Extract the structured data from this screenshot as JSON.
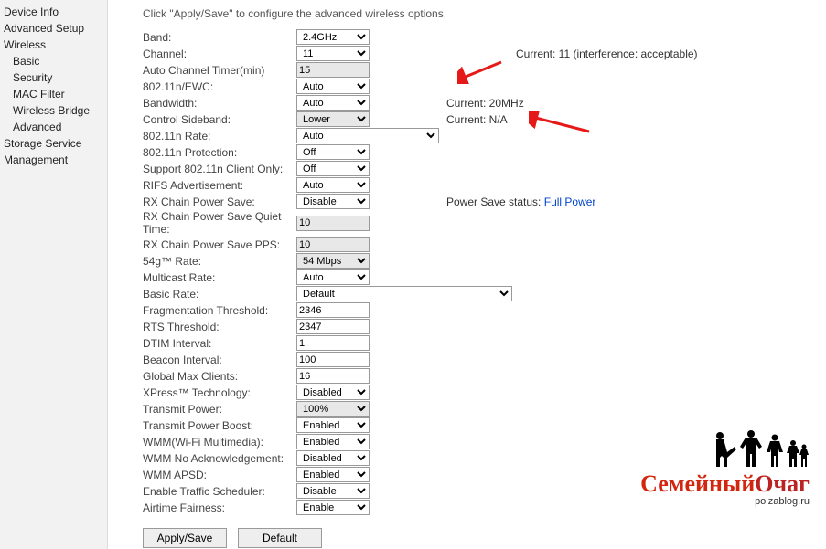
{
  "sidebar": {
    "items": [
      {
        "label": "Device Info",
        "sub": false
      },
      {
        "label": "Advanced Setup",
        "sub": false
      },
      {
        "label": "Wireless",
        "sub": false
      },
      {
        "label": "Basic",
        "sub": true
      },
      {
        "label": "Security",
        "sub": true
      },
      {
        "label": "MAC Filter",
        "sub": true
      },
      {
        "label": "Wireless Bridge",
        "sub": true
      },
      {
        "label": "Advanced",
        "sub": true
      },
      {
        "label": "Storage Service",
        "sub": false
      },
      {
        "label": "Management",
        "sub": false
      }
    ]
  },
  "intro": "Click \"Apply/Save\" to configure the advanced wireless options.",
  "rows": [
    {
      "key": "band",
      "label": "Band:",
      "type": "select",
      "value": "2.4GHz",
      "width": "n"
    },
    {
      "key": "channel",
      "label": "Channel:",
      "type": "select",
      "value": "11",
      "width": "n",
      "aux": "Current: 11 (interference: acceptable)",
      "auxFar": true
    },
    {
      "key": "autochan",
      "label": "Auto Channel Timer(min)",
      "type": "input",
      "value": "15",
      "width": "n",
      "readonly": true
    },
    {
      "key": "ewc",
      "label": "802.11n/EWC:",
      "type": "select",
      "value": "Auto",
      "width": "n"
    },
    {
      "key": "bw",
      "label": "Bandwidth:",
      "type": "select",
      "value": "Auto",
      "width": "n",
      "aux": "Current: 20MHz"
    },
    {
      "key": "ctrlsb",
      "label": "Control Sideband:",
      "type": "select",
      "value": "Lower",
      "width": "n",
      "aux": "Current: N/A",
      "readonly": true
    },
    {
      "key": "nrate",
      "label": "802.11n Rate:",
      "type": "select",
      "value": "Auto",
      "width": "wide"
    },
    {
      "key": "nprot",
      "label": "802.11n Protection:",
      "type": "select",
      "value": "Off",
      "width": "n"
    },
    {
      "key": "nclient",
      "label": "Support 802.11n Client Only:",
      "type": "select",
      "value": "Off",
      "width": "n"
    },
    {
      "key": "rifs",
      "label": "RIFS Advertisement:",
      "type": "select",
      "value": "Auto",
      "width": "n"
    },
    {
      "key": "rxps",
      "label": "RX Chain Power Save:",
      "type": "select",
      "value": "Disable",
      "width": "n",
      "aux": "Power Save status:",
      "auxLink": "Full Power"
    },
    {
      "key": "rxpsq",
      "label": "RX Chain Power Save Quiet Time:",
      "type": "input",
      "value": "10",
      "width": "n",
      "readonly": true,
      "tall": true
    },
    {
      "key": "rxpps",
      "label": "RX Chain Power Save PPS:",
      "type": "input",
      "value": "10",
      "width": "n",
      "readonly": true
    },
    {
      "key": "g54",
      "label": "54g™ Rate:",
      "type": "select",
      "value": "54 Mbps",
      "width": "n",
      "readonly": true
    },
    {
      "key": "mcast",
      "label": "Multicast Rate:",
      "type": "select",
      "value": "Auto",
      "width": "n"
    },
    {
      "key": "brate",
      "label": "Basic Rate:",
      "type": "select",
      "value": "Default",
      "width": "xwide"
    },
    {
      "key": "frag",
      "label": "Fragmentation Threshold:",
      "type": "input",
      "value": "2346",
      "width": "n"
    },
    {
      "key": "rts",
      "label": "RTS Threshold:",
      "type": "input",
      "value": "2347",
      "width": "n"
    },
    {
      "key": "dtim",
      "label": "DTIM Interval:",
      "type": "input",
      "value": "1",
      "width": "n"
    },
    {
      "key": "beacon",
      "label": "Beacon Interval:",
      "type": "input",
      "value": "100",
      "width": "n"
    },
    {
      "key": "maxc",
      "label": "Global Max Clients:",
      "type": "input",
      "value": "16",
      "width": "n"
    },
    {
      "key": "xpress",
      "label": "XPress™ Technology:",
      "type": "select",
      "value": "Disabled",
      "width": "n"
    },
    {
      "key": "txp",
      "label": "Transmit Power:",
      "type": "select",
      "value": "100%",
      "width": "n",
      "readonly": true
    },
    {
      "key": "txpb",
      "label": "Transmit Power Boost:",
      "type": "select",
      "value": "Enabled",
      "width": "n"
    },
    {
      "key": "wmm",
      "label": "WMM(Wi-Fi Multimedia):",
      "type": "select",
      "value": "Enabled",
      "width": "n"
    },
    {
      "key": "wmmna",
      "label": "WMM No Acknowledgement:",
      "type": "select",
      "value": "Disabled",
      "width": "n"
    },
    {
      "key": "wmmap",
      "label": "WMM APSD:",
      "type": "select",
      "value": "Enabled",
      "width": "n"
    },
    {
      "key": "ets",
      "label": "Enable Traffic Scheduler:",
      "type": "select",
      "value": "Disable",
      "width": "n"
    },
    {
      "key": "af",
      "label": "Airtime Fairness:",
      "type": "select",
      "value": "Enable",
      "width": "n"
    }
  ],
  "buttons": {
    "apply": "Apply/Save",
    "default": "Default"
  },
  "watermark": {
    "text1": "Семейный",
    "text2": "Очаг",
    "sub": "polzablog.ru"
  }
}
